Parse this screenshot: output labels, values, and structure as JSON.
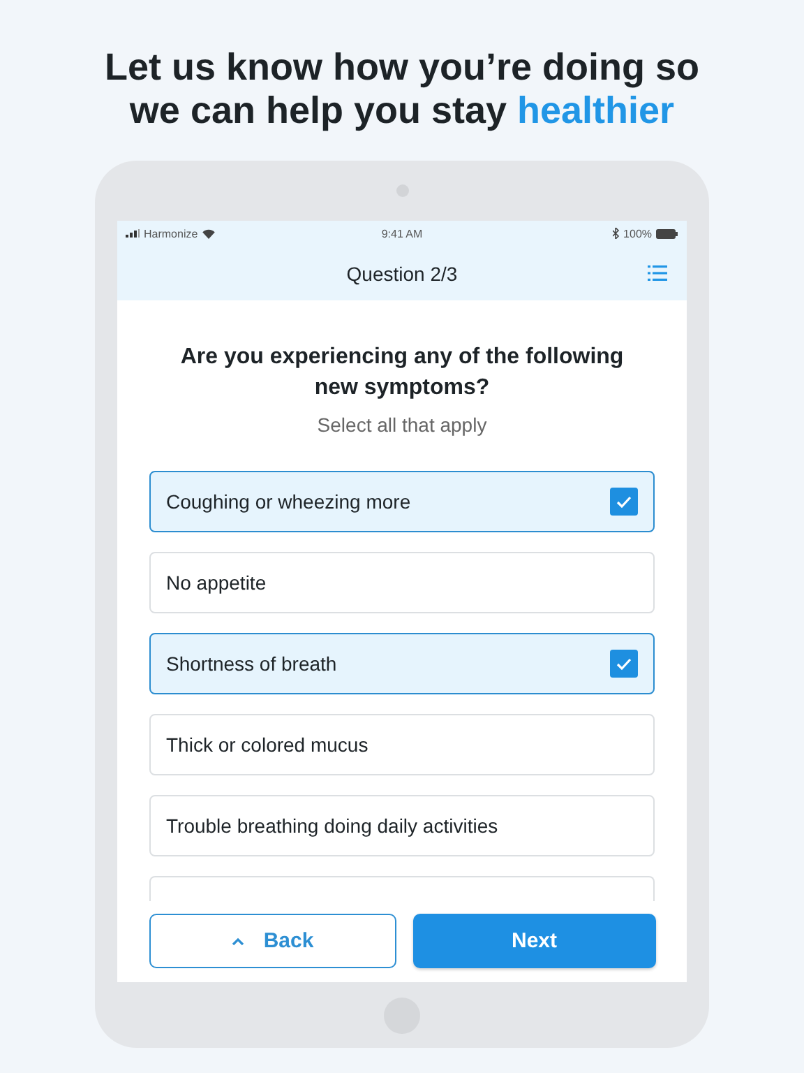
{
  "headline": {
    "text": "Let us know how you’re doing so we can help you stay",
    "highlight": "healthier"
  },
  "status_bar": {
    "carrier": "Harmonize",
    "time": "9:41 AM",
    "battery": "100%"
  },
  "nav": {
    "title": "Question 2/3"
  },
  "question": {
    "title": "Are you experiencing any of the following new symptoms?",
    "hint": "Select all that apply"
  },
  "options": [
    {
      "label": "Coughing or wheezing more",
      "selected": true
    },
    {
      "label": "No appetite",
      "selected": false
    },
    {
      "label": "Shortness of breath",
      "selected": true
    },
    {
      "label": "Thick or colored mucus",
      "selected": false
    },
    {
      "label": "Trouble breathing doing daily activities",
      "selected": false
    }
  ],
  "buttons": {
    "back": "Back",
    "next": "Next"
  }
}
